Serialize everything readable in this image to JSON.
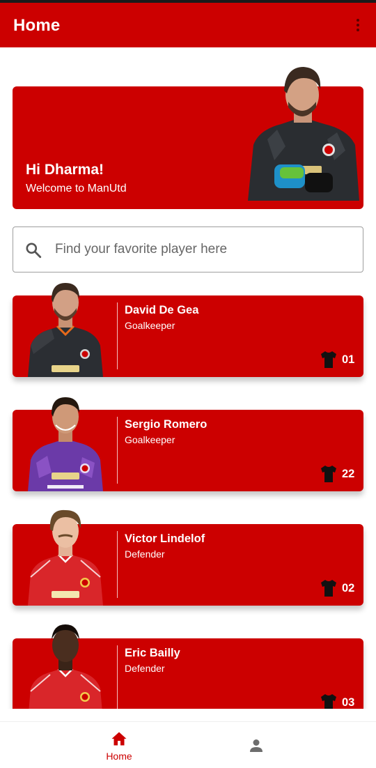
{
  "appbar": {
    "title": "Home",
    "menu_icon": "more-vert-icon"
  },
  "hero": {
    "greeting": "Hi Dharma!",
    "subtitle": "Welcome to ManUtd"
  },
  "search": {
    "placeholder": "Find your favorite player here",
    "value": "",
    "icon": "search-icon"
  },
  "players": [
    {
      "name": "David De Gea",
      "position": "Goalkeeper",
      "number": "01",
      "kit": "goalkeeper-black"
    },
    {
      "name": "Sergio Romero",
      "position": "Goalkeeper",
      "number": "22",
      "kit": "goalkeeper-purple"
    },
    {
      "name": "Victor Lindelof",
      "position": "Defender",
      "number": "02",
      "kit": "home-red"
    },
    {
      "name": "Eric Bailly",
      "position": "Defender",
      "number": "03",
      "kit": "home-red"
    }
  ],
  "bottom_nav": {
    "items": [
      {
        "label": "Home",
        "icon": "home-icon",
        "active": true
      },
      {
        "label": "",
        "icon": "person-icon",
        "active": false
      }
    ]
  },
  "colors": {
    "primary": "#cc0000",
    "on_primary": "#ffffff",
    "background": "#ffffff"
  }
}
